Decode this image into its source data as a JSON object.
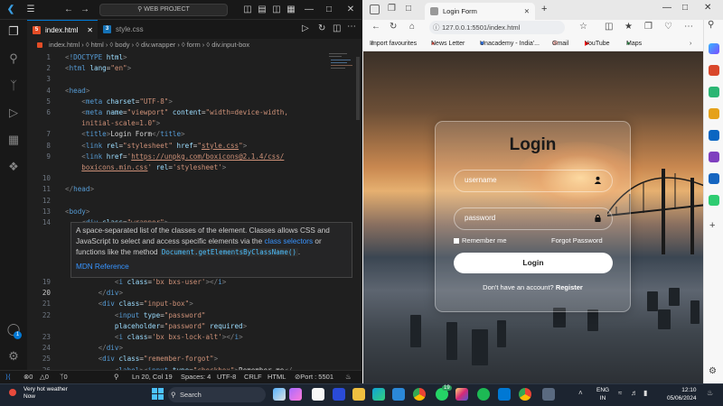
{
  "vscode": {
    "search_label": "WEB PROJECT",
    "tabs": [
      {
        "label": "index.html",
        "type_icon": "html5-icon",
        "active": true
      },
      {
        "label": "style.css",
        "type_icon": "css3-icon",
        "active": false
      }
    ],
    "breadcrumb": [
      "index.html",
      "html",
      "body",
      "div.wrapper",
      "form",
      "div.input-box"
    ],
    "code_lines": [
      {
        "n": "1",
        "html": "<span class=\"br\">&lt;</span><span class=\"tg\">!DOCTYPE</span> <span class=\"at\">html</span><span class=\"br\">&gt;</span>"
      },
      {
        "n": "2",
        "html": "<span class=\"br\">&lt;</span><span class=\"tg\">html</span> <span class=\"at\">lang</span>=<span class=\"st\">\"en\"</span><span class=\"br\">&gt;</span>"
      },
      {
        "n": "3",
        "html": ""
      },
      {
        "n": "4",
        "html": "<span class=\"br\">&lt;</span><span class=\"tg\">head</span><span class=\"br\">&gt;</span>"
      },
      {
        "n": "5",
        "html": "    <span class=\"br\">&lt;</span><span class=\"tg\">meta</span> <span class=\"at\">charset</span>=<span class=\"st\">\"UTF-8\"</span><span class=\"br\">&gt;</span>"
      },
      {
        "n": "6",
        "html": "    <span class=\"br\">&lt;</span><span class=\"tg\">meta</span> <span class=\"at\">name</span>=<span class=\"st\">\"viewport\"</span> <span class=\"at\">content</span>=<span class=\"st\">\"width=device-width,</span>"
      },
      {
        "n": "",
        "html": "    <span class=\"st\">initial-scale=1.0\"</span><span class=\"br\">&gt;</span>"
      },
      {
        "n": "7",
        "html": "    <span class=\"br\">&lt;</span><span class=\"tg\">title</span><span class=\"br\">&gt;</span><span class=\"tx\">Login Form</span><span class=\"br\">&lt;/</span><span class=\"tg\">title</span><span class=\"br\">&gt;</span>"
      },
      {
        "n": "8",
        "html": "    <span class=\"br\">&lt;</span><span class=\"tg\">link</span> <span class=\"at\">rel</span>=<span class=\"st\">\"stylesheet\"</span> <span class=\"at\">href</span>=<span class=\"st\">\"<span class=\"ul\">style.css</span>\"</span><span class=\"br\">&gt;</span>"
      },
      {
        "n": "9",
        "html": "    <span class=\"br\">&lt;</span><span class=\"tg\">link</span> <span class=\"at\">href</span>=<span class=\"st\">'<span class=\"ul\">https://unpkg.com/boxicons@2.1.4/css/</span></span>"
      },
      {
        "n": "",
        "html": "    <span class=\"st\"><span class=\"ul\">boxicons.min.css</span>'</span> <span class=\"at\">rel</span>=<span class=\"st\">'stylesheet'</span><span class=\"br\">&gt;</span>"
      },
      {
        "n": "10",
        "html": ""
      },
      {
        "n": "11",
        "html": "<span class=\"br\">&lt;/</span><span class=\"tg\">head</span><span class=\"br\">&gt;</span>"
      },
      {
        "n": "12",
        "html": ""
      },
      {
        "n": "13",
        "html": "<span class=\"br\">&lt;</span><span class=\"tg\">body</span><span class=\"br\">&gt;</span>"
      },
      {
        "n": "14",
        "html": "    <span class=\"br\">&lt;</span><span class=\"tg\">div</span> <span class=\"at\">class</span>=<span class=\"st\">\"wrapper\"</span><span class=\"br\">&gt;</span>"
      }
    ],
    "code_lines_after": [
      {
        "n": "19",
        "html": "            <span class=\"br\">&lt;</span><span class=\"tg\">i</span> <span class=\"at\">class</span>=<span class=\"st\">'bx bxs-user'</span><span class=\"br\">&gt;&lt;/</span><span class=\"tg\">i</span><span class=\"br\">&gt;</span>"
      },
      {
        "n": "20",
        "html": "        <span class=\"br\">&lt;/</span><span class=\"tg\">div</span><span class=\"br\">&gt;</span>"
      },
      {
        "n": "21",
        "html": "        <span class=\"br\">&lt;</span><span class=\"tg\">div</span> <span class=\"at\">class</span>=<span class=\"st\">\"input-box\"</span><span class=\"br\">&gt;</span>"
      },
      {
        "n": "22",
        "html": "            <span class=\"br\">&lt;</span><span class=\"tg\">input</span> <span class=\"at\">type</span>=<span class=\"st\">\"password\"</span>"
      },
      {
        "n": "",
        "html": "            <span class=\"at\">placeholder</span>=<span class=\"st\">\"password\"</span> <span class=\"at\">required</span><span class=\"br\">&gt;</span>"
      },
      {
        "n": "23",
        "html": "            <span class=\"br\">&lt;</span><span class=\"tg\">i</span> <span class=\"at\">class</span>=<span class=\"st\">'bx bxs-lock-alt'</span><span class=\"br\">&gt;&lt;/</span><span class=\"tg\">i</span><span class=\"br\">&gt;</span>"
      },
      {
        "n": "24",
        "html": "        <span class=\"br\">&lt;/</span><span class=\"tg\">div</span><span class=\"br\">&gt;</span>"
      },
      {
        "n": "25",
        "html": "        <span class=\"br\">&lt;</span><span class=\"tg\">div</span> <span class=\"at\">class</span>=<span class=\"st\">\"remember-forgot\"</span><span class=\"br\">&gt;</span>"
      },
      {
        "n": "26",
        "html": "            <span class=\"br\">&lt;</span><span class=\"tg\">label</span><span class=\"br\">&gt;&lt;</span><span class=\"tg\">input</span> <span class=\"at\">type</span>=<span class=\"st\">\"checkbox\"</span><span class=\"br\">&gt;</span><span class=\"tx\">Remember me</span><span class=\"br\">&lt;/</span>"
      }
    ],
    "hover": {
      "line1": "A space-separated list of the classes of the element. Classes allows CSS and",
      "line2a": "JavaScript to select and access specific elements via the ",
      "line2link": "class selectors",
      "line2b": " or",
      "line3a": "functions like the method ",
      "line3code": "Document.getElementsByClassName()",
      "line3b": ".",
      "mdn": "MDN Reference"
    },
    "status": {
      "errors": "0",
      "warnings": "0",
      "ports": "0",
      "position": "Ln 20, Col 19",
      "spaces": "Spaces: 4",
      "encoding": "UTF-8",
      "eol": "CRLF",
      "language": "HTML",
      "port": "Port : 5501"
    },
    "account_badge": "1"
  },
  "browser": {
    "tab_title": "Login Form",
    "url": "127.0.0.1:5501/index.html",
    "bookmarks": [
      "Import favourites",
      "News Letter",
      "Unacademy - India'...",
      "Gmail",
      "YouTube",
      "Maps"
    ]
  },
  "login": {
    "title": "Login",
    "username_placeholder": "username",
    "password_placeholder": "password",
    "remember": "Remember me",
    "forgot": "Forgot Password",
    "button": "Login",
    "register_prompt": "Don't have an account?",
    "register_link": "Register"
  },
  "taskbar": {
    "weather_title": "Very hot weather",
    "weather_sub": "Now",
    "search": "Search",
    "lang": "ENG",
    "region": "IN",
    "time": "12:10",
    "date": "05/06/2024",
    "whatsapp_badge": "19"
  }
}
